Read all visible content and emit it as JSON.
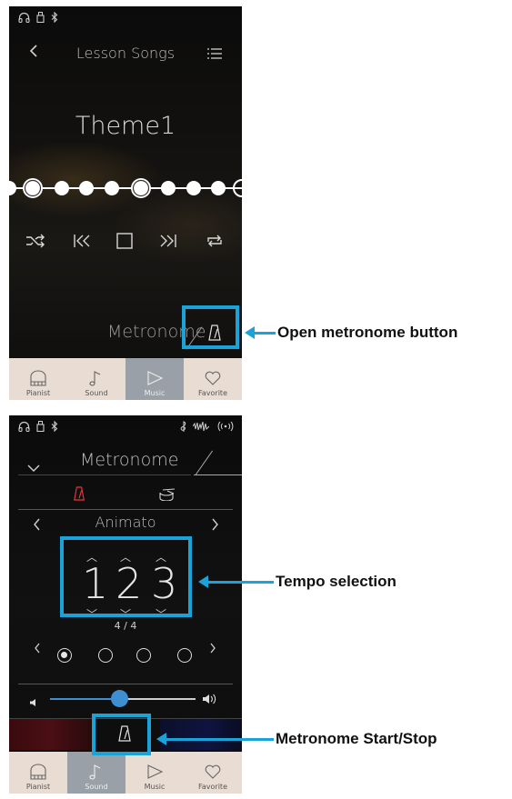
{
  "screen1": {
    "title": "Lesson Songs",
    "song": "Theme1",
    "metronome_label": "Metronome"
  },
  "screen2": {
    "title": "Metronome",
    "rhythm": "Animato",
    "tempo_digits": [
      "1",
      "2",
      "3"
    ],
    "time_signature": "4 / 4"
  },
  "nav": {
    "items": [
      "Pianist",
      "Sound",
      "Music",
      "Favorite"
    ]
  },
  "callouts": {
    "open_metronome": "Open metronome button",
    "tempo_selection": "Tempo selection",
    "start_stop": "Metronome Start/Stop"
  },
  "colors": {
    "accent": "#1aa3d9",
    "metronome_active": "#e53935",
    "nav_bg": "#e9dcd3",
    "nav_active": "#9aa0a8",
    "slider_knob": "#3d8fd1"
  }
}
